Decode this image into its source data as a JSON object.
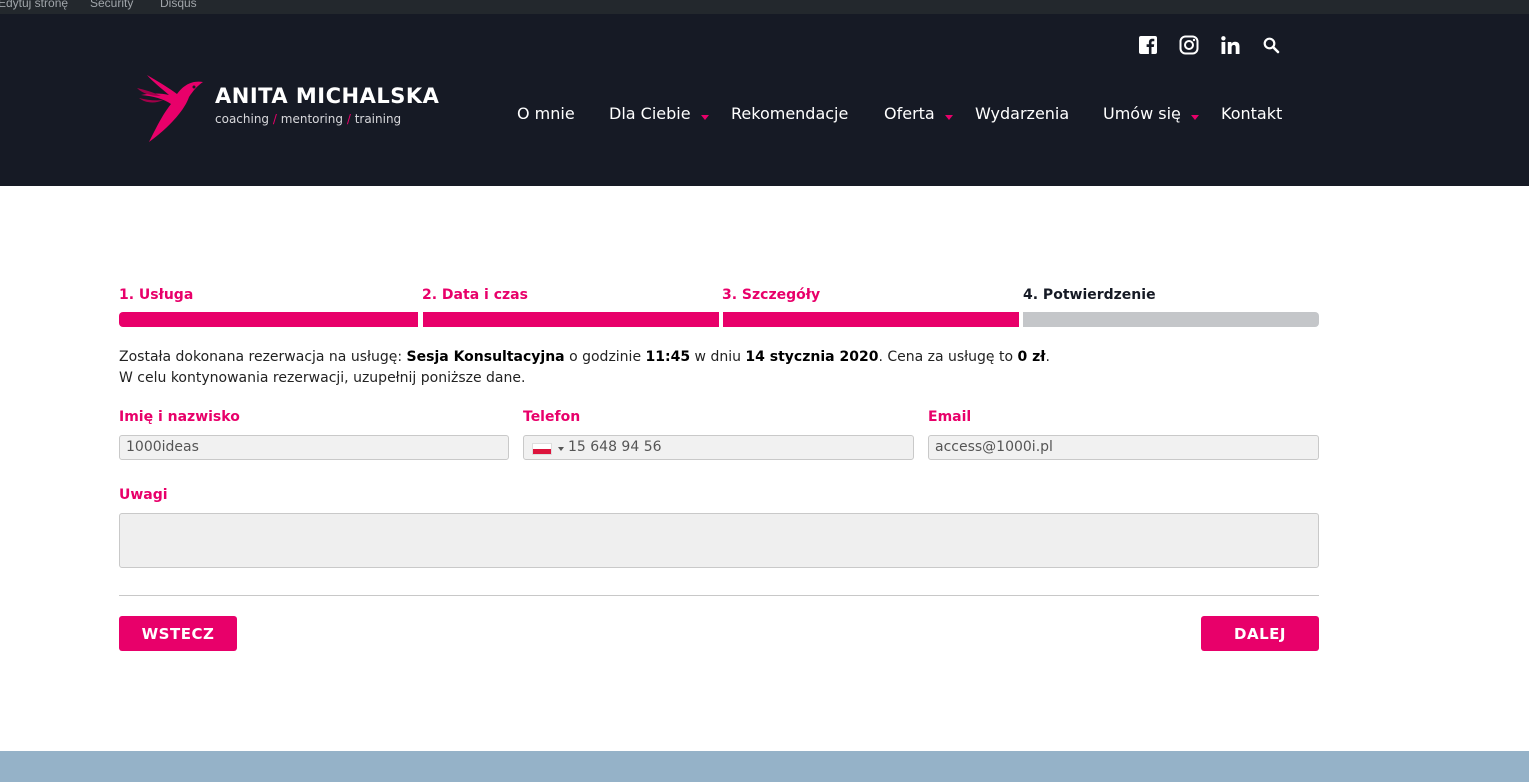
{
  "adminbar": {
    "items": [
      "Edytuj stronę",
      "Security",
      "Disqus"
    ]
  },
  "header": {
    "social": [
      "facebook-icon",
      "instagram-icon",
      "linkedin-icon",
      "search-icon"
    ],
    "logo": {
      "name": "ANITA MICHALSKA",
      "tag_1": "coaching",
      "tag_2": "mentoring",
      "tag_3": "training",
      "separator": "/"
    },
    "nav": [
      {
        "label": "O mnie",
        "dropdown": false
      },
      {
        "label": "Dla Ciebie",
        "dropdown": true
      },
      {
        "label": "Rekomendacje",
        "dropdown": false
      },
      {
        "label": "Oferta",
        "dropdown": true
      },
      {
        "label": "Wydarzenia",
        "dropdown": false
      },
      {
        "label": "Umów się",
        "dropdown": true
      },
      {
        "label": "Kontakt",
        "dropdown": false
      }
    ]
  },
  "steps": [
    {
      "label": "1. Usługa",
      "state": "done"
    },
    {
      "label": "2. Data i czas",
      "state": "done"
    },
    {
      "label": "3. Szczegóły",
      "state": "done"
    },
    {
      "label": "4. Potwierdzenie",
      "state": "current"
    }
  ],
  "booking": {
    "line1_a": "Została dokonana rezerwacja na usługę: ",
    "service": "Sesja Konsultacyjna",
    "line1_b": " o godzinie ",
    "time": "11:45",
    "line1_c": " w dniu ",
    "date": "14 stycznia 2020",
    "line1_d": ". Cena za usługę to ",
    "price": "0 zł",
    "line1_e": ".",
    "line2": "W celu kontynowania rezerwacji, uzupełnij poniższe dane."
  },
  "form": {
    "name_label": "Imię i nazwisko",
    "name_value": "1000ideas",
    "phone_label": "Telefon",
    "phone_value": "15 648 94 56",
    "email_label": "Email",
    "email_value": "access@1000i.pl",
    "notes_label": "Uwagi",
    "notes_value": ""
  },
  "buttons": {
    "back": "WSTECZ",
    "next": "DALEJ"
  },
  "colors": {
    "accent": "#e8006a",
    "header_bg": "#161a25",
    "bar_pending": "#c4c6c9",
    "footer_bg": "#95b2c8"
  }
}
